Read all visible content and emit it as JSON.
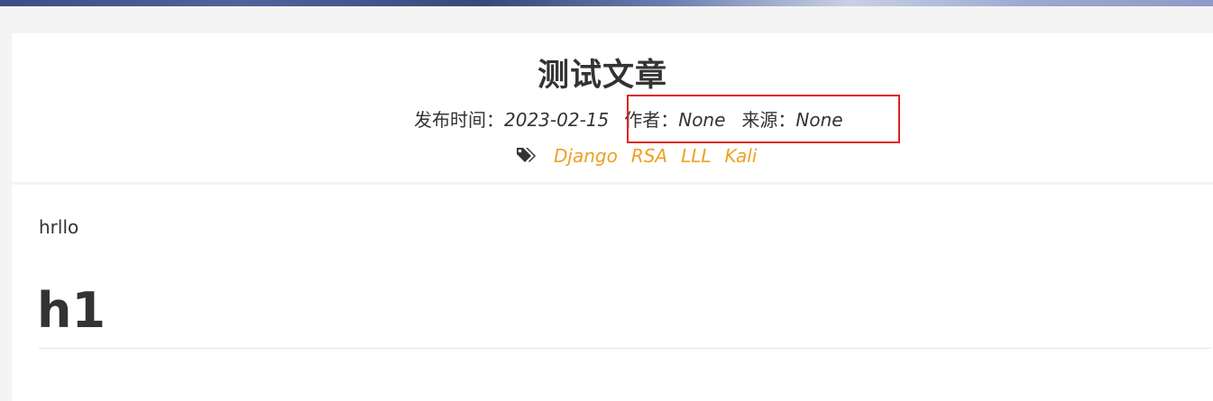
{
  "article": {
    "title": "测试文章",
    "meta": {
      "publish_label": "发布时间：",
      "publish_date": "2023-02-15",
      "author_label": "作者：",
      "author_value": "None",
      "source_label": "来源：",
      "source_value": "None"
    },
    "tags_icon": "tags-icon",
    "tags": [
      "Django",
      "RSA",
      "LLL",
      "Kali"
    ]
  },
  "content": {
    "paragraph": "hrllo",
    "heading": "h1"
  },
  "colors": {
    "tag_link": "#f0a020",
    "highlight_border": "#e02020"
  }
}
